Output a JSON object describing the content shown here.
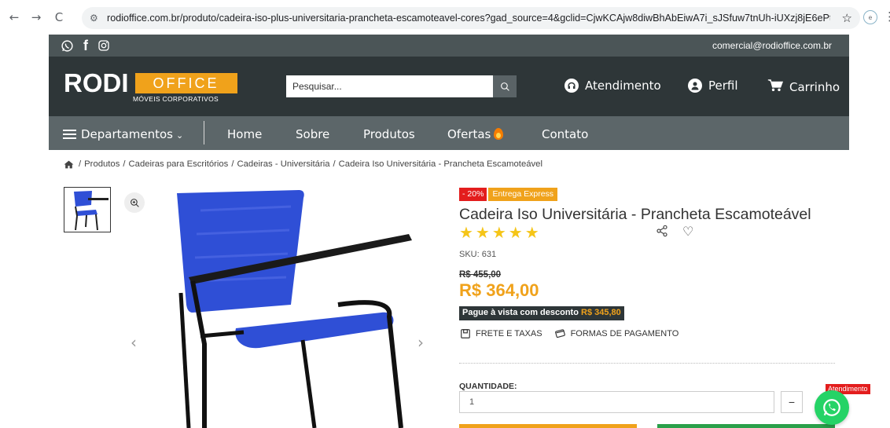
{
  "browser": {
    "url": "rodioffice.com.br/produto/cadeira-iso-plus-universitaria-prancheta-escamoteavel-cores?gad_source=4&gclid=CjwKCAjw8diwBhAbEiwA7i_sJSfuw7tnUh-iUXzj8jE6ePtlRglCoBL...",
    "back_icon": "arrow-left-icon",
    "forward_icon": "arrow-right-icon",
    "reload_icon": "reload-icon"
  },
  "top_bar": {
    "email": "comercial@rodioffice.com.br",
    "social_icons": [
      "whatsapp-icon",
      "facebook-icon",
      "instagram-icon"
    ]
  },
  "header": {
    "logo_main": "RODI",
    "logo_box": "OFFICE",
    "logo_sub": "MÓVEIS CORPORATIVOS",
    "search_placeholder": "Pesquisar...",
    "atendimento": "Atendimento",
    "perfil": "Perfil",
    "carrinho": "Carrinho"
  },
  "nav": {
    "departamentos": "Departamentos",
    "home": "Home",
    "sobre": "Sobre",
    "produtos": "Produtos",
    "ofertas": "Ofertas",
    "contato": "Contato"
  },
  "breadcrumb": {
    "items": [
      "Produtos",
      "Cadeiras para Escritórios",
      "Cadeiras - Universitária",
      "Cadeira Iso Universitária - Prancheta Escamoteável"
    ]
  },
  "product": {
    "badge_discount": "- 20%",
    "badge_express": "Entrega Express",
    "title": "Cadeira Iso Universitária - Prancheta Escamoteável",
    "rating_stars": 5,
    "sku": "SKU: 631",
    "old_price": "R$ 455,00",
    "price": "R$ 364,00",
    "cash_label": "Pague à vista com desconto",
    "cash_price": "R$ 345,80",
    "frete": "FRETE E TAXAS",
    "formas": "FORMAS DE PAGAMENTO",
    "qty_label": "QUANTIDADE:",
    "qty_value": "1",
    "qty_minus": "−",
    "chair_color": "#2f4fd6"
  },
  "whatsapp": {
    "label": "Atendimento"
  },
  "colors": {
    "accent": "#f0a21b",
    "header_dark": "#2e3638",
    "nav": "#5c6669",
    "discount": "#e31d1d",
    "whatsapp": "#25d366"
  }
}
